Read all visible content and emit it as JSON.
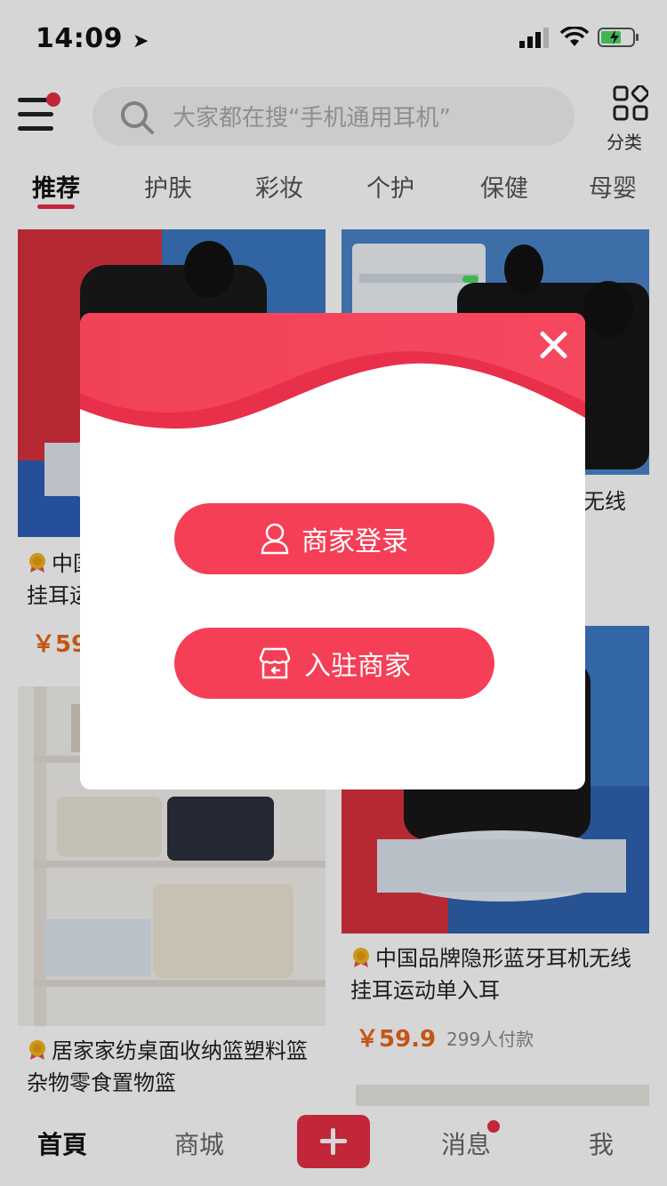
{
  "status_bar": {
    "time": "14:09"
  },
  "header": {
    "search_placeholder": "大家都在搜“手机通用耳机”",
    "category_label": "分类"
  },
  "tabs": [
    "推荐",
    "护肤",
    "彩妆",
    "个护",
    "保健",
    "母婴"
  ],
  "products": [
    {
      "title_line1": "中国",
      "title_line2": "挂耳运",
      "price": "￥59"
    },
    {
      "title_line1": "机无线"
    },
    {
      "title_line1": "居家家纺桌面收纳篮塑料篮",
      "title_line2": "杂物零食置物篮"
    },
    {
      "title_line1": "中国品牌隐形蓝牙耳机无线",
      "title_line2": "挂耳运动单入耳",
      "price": "￥59.9",
      "paid": "299人付款"
    }
  ],
  "modal": {
    "merchant_login": "商家登录",
    "join_merchant": "入驻商家"
  },
  "tabbar": {
    "home": "首頁",
    "mall": "商城",
    "messages": "消息",
    "me": "我"
  },
  "colors": {
    "accent": "#f43f57",
    "price": "#e8661a"
  }
}
